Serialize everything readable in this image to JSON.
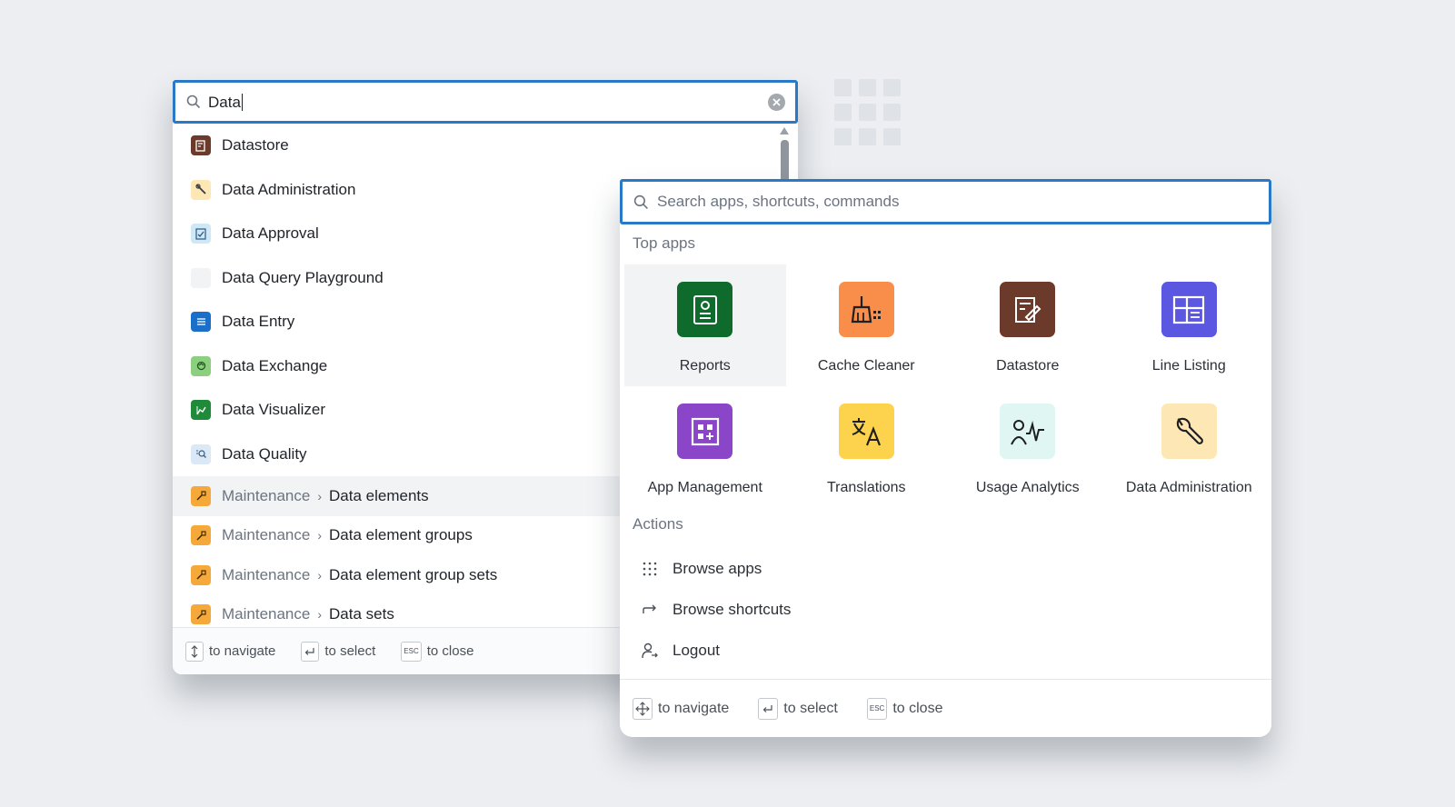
{
  "left_panel": {
    "search": {
      "value": "Data"
    },
    "results": [
      {
        "label": "Datastore",
        "icon": "datastore-icon",
        "color": "#6b3a2a"
      },
      {
        "label": "Data Administration",
        "icon": "wrench-icon",
        "color": "#fde7b4"
      },
      {
        "label": "Data Approval",
        "icon": "approval-icon",
        "color": "#cfe8f7"
      },
      {
        "label": "Data Query Playground",
        "icon": "query-icon",
        "color": "#f1f3f5"
      },
      {
        "label": "Data Entry",
        "icon": "entry-icon",
        "color": "#1b6fc9"
      },
      {
        "label": "Data Exchange",
        "icon": "exchange-icon",
        "color": "#8ccf7e"
      },
      {
        "label": "Data Visualizer",
        "icon": "visualizer-icon",
        "color": "#1f8a3a"
      },
      {
        "label": "Data Quality",
        "icon": "quality-icon",
        "color": "#dbe8f5"
      }
    ],
    "shortcuts": [
      {
        "parent": "Maintenance",
        "label": "Data elements"
      },
      {
        "parent": "Maintenance",
        "label": "Data element groups"
      },
      {
        "parent": "Maintenance",
        "label": "Data element group sets"
      },
      {
        "parent": "Maintenance",
        "label": "Data sets"
      }
    ],
    "footer": {
      "navigate": "to navigate",
      "select": "to select",
      "close": "to close",
      "esc_key": "ESC"
    }
  },
  "right_panel": {
    "search": {
      "placeholder": "Search apps, shortcuts, commands"
    },
    "top_apps_title": "Top apps",
    "apps": [
      {
        "label": "Reports",
        "icon": "reports-icon",
        "color": "#0f6b2c"
      },
      {
        "label": "Cache Cleaner",
        "icon": "cache-cleaner-icon",
        "color": "#f98d4a"
      },
      {
        "label": "Datastore",
        "icon": "datastore-icon",
        "color": "#6b3a2a"
      },
      {
        "label": "Line Listing",
        "icon": "line-listing-icon",
        "color": "#5b57e0"
      },
      {
        "label": "App Management",
        "icon": "app-management-icon",
        "color": "#8b45c8"
      },
      {
        "label": "Translations",
        "icon": "translations-icon",
        "color": "#fdd24d"
      },
      {
        "label": "Usage Analytics",
        "icon": "usage-analytics-icon",
        "color": "#dff6f3"
      },
      {
        "label": "Data Administration",
        "icon": "wrench-icon",
        "color": "#fde7b4"
      }
    ],
    "actions_title": "Actions",
    "actions": [
      {
        "label": "Browse apps",
        "icon": "grid-dots-icon"
      },
      {
        "label": "Browse shortcuts",
        "icon": "shortcut-arrow-icon"
      },
      {
        "label": "Logout",
        "icon": "logout-icon"
      }
    ],
    "footer": {
      "navigate": "to navigate",
      "select": "to select",
      "close": "to close",
      "esc_key": "ESC"
    }
  }
}
